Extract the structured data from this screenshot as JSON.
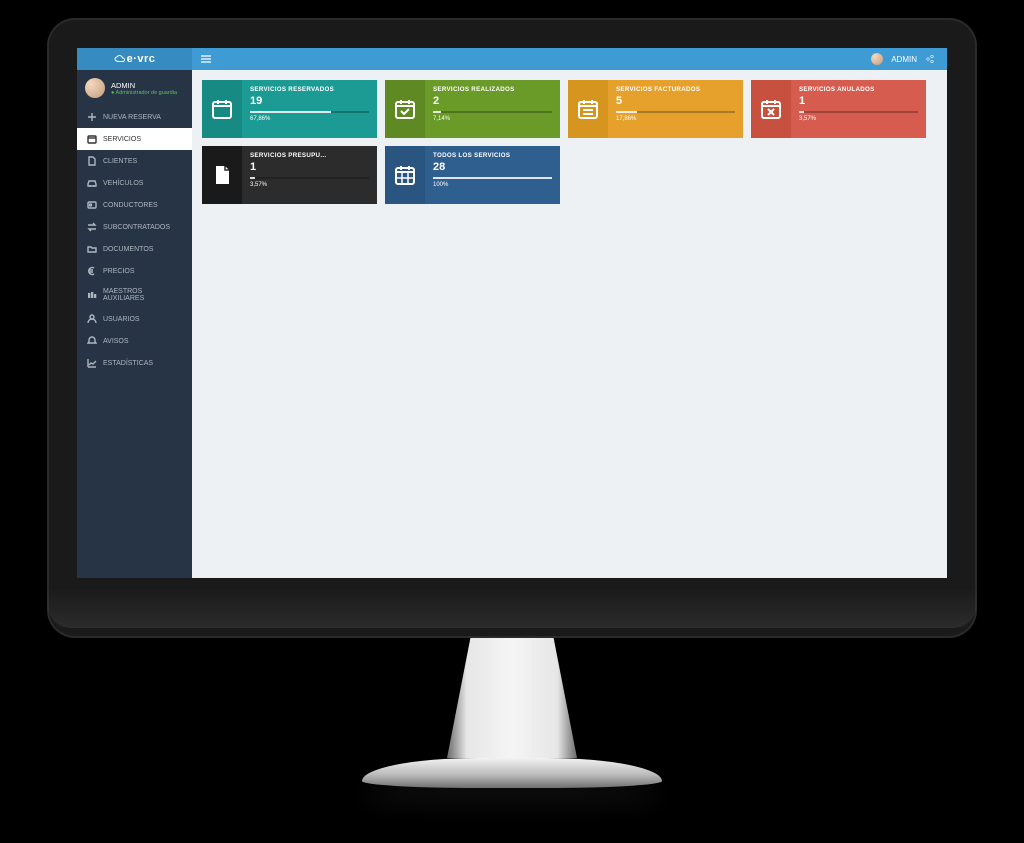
{
  "brand": "e·vrc",
  "topbar": {
    "username": "ADMIN"
  },
  "user": {
    "name": "ADMIN",
    "role": "Administrador de guardia"
  },
  "nav": {
    "items": [
      {
        "icon": "plus",
        "label": "NUEVA RESERVA"
      },
      {
        "icon": "calendar",
        "label": "SERVICIOS",
        "active": true
      },
      {
        "icon": "file",
        "label": "CLIENTES"
      },
      {
        "icon": "car",
        "label": "VEHÍCULOS"
      },
      {
        "icon": "id",
        "label": "CONDUCTORES"
      },
      {
        "icon": "exchange",
        "label": "SUBCONTRATADOS"
      },
      {
        "icon": "folder",
        "label": "DOCUMENTOS"
      },
      {
        "icon": "euro",
        "label": "PRECIOS"
      },
      {
        "icon": "db",
        "label": "MAESTROS AUXILIARES"
      },
      {
        "icon": "user",
        "label": "USUARIOS"
      },
      {
        "icon": "bell",
        "label": "AVISOS"
      },
      {
        "icon": "chart",
        "label": "ESTADÍSTICAS"
      }
    ]
  },
  "cards": [
    {
      "color": "teal",
      "icon": "cal",
      "title": "SERVICIOS RESERVADOS",
      "value": "19",
      "percent": "67,86%",
      "bar": 68
    },
    {
      "color": "green",
      "icon": "cal-check",
      "title": "SERVICIOS REALIZADOS",
      "value": "2",
      "percent": "7,14%",
      "bar": 7
    },
    {
      "color": "amber",
      "icon": "cal-lines",
      "title": "SERVICIOS FACTURADOS",
      "value": "5",
      "percent": "17,86%",
      "bar": 18
    },
    {
      "color": "red",
      "icon": "cal-x",
      "title": "SERVICIOS ANULADOS",
      "value": "1",
      "percent": "3,57%",
      "bar": 4
    },
    {
      "color": "black",
      "icon": "doc",
      "title": "SERVICIOS PRESUPU...",
      "value": "1",
      "percent": "3,57%",
      "bar": 4
    },
    {
      "color": "blue",
      "icon": "cal-grid",
      "title": "TODOS LOS SERVICIOS",
      "value": "28",
      "percent": "100%",
      "bar": 100
    }
  ]
}
